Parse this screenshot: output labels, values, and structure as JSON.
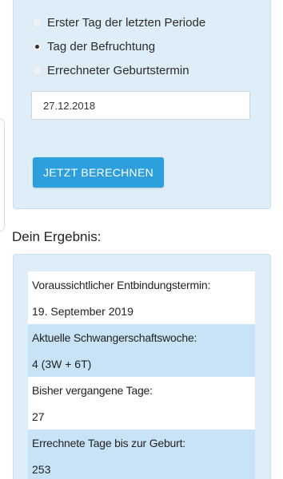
{
  "form": {
    "radio_options": [
      {
        "label": "Erster Tag der letzten Periode",
        "checked": false
      },
      {
        "label": "Tag der Befruchtung",
        "checked": true
      },
      {
        "label": "Errechneter Geburtstermin",
        "checked": false
      }
    ],
    "date_value": "27.12.2018",
    "submit_label": "JETZT BERECHNEN"
  },
  "results": {
    "heading": "Dein Ergebnis:",
    "rows": [
      {
        "label": "Voraussichtlicher Entbindungstermin:",
        "value": "19. September 2019"
      },
      {
        "label": "Aktuelle Schwangerschaftswoche:",
        "value": "4 (3W + 6T)"
      },
      {
        "label": "Bisher vergangene Tage:",
        "value": "27"
      },
      {
        "label": "Errechnete Tage bis zur Geburt:",
        "value": "253"
      }
    ]
  },
  "colors": {
    "panel_bg": "#ddeef9",
    "button_bg": "#2e9fdd",
    "row_alt_bg": "#c9e3f6"
  }
}
